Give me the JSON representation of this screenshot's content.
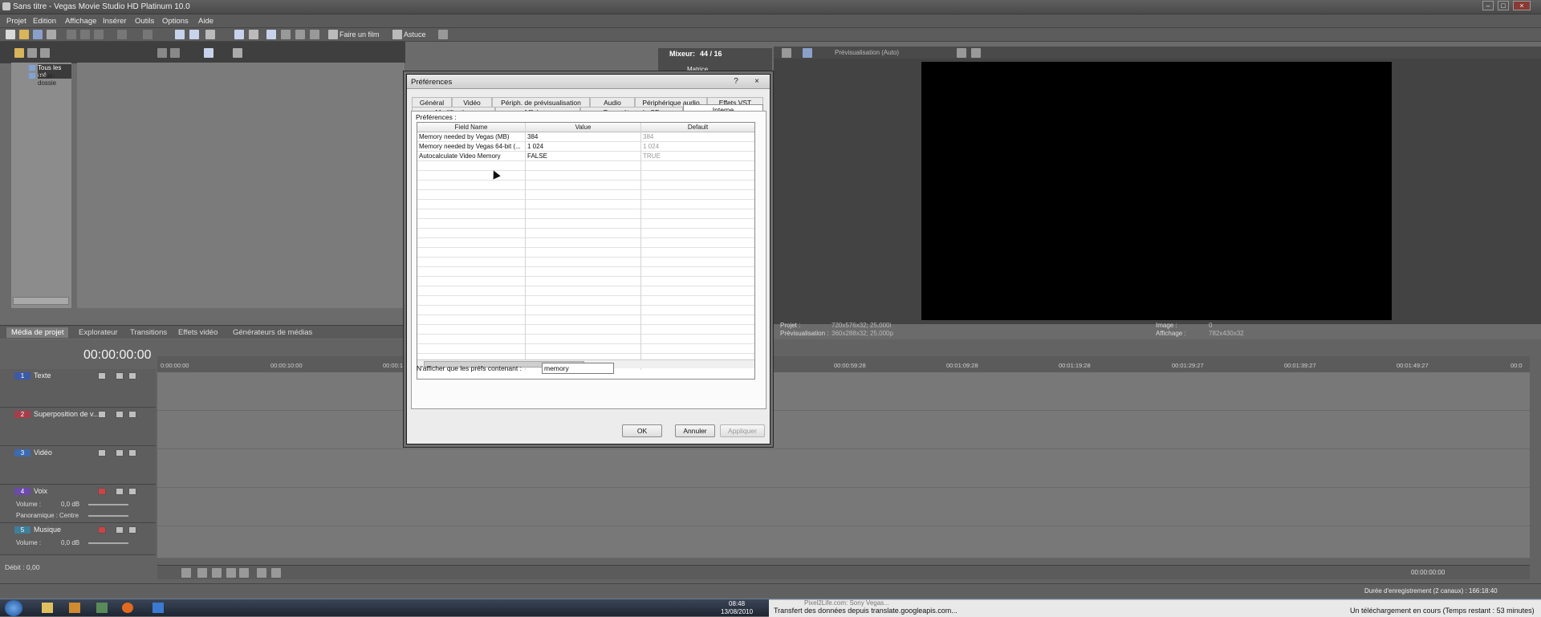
{
  "window": {
    "title": "Sans titre - Vegas Movie Studio HD Platinum 10.0"
  },
  "menu": [
    "Projet",
    "Edition",
    "Affichage",
    "Insérer",
    "Outils",
    "Options",
    "Aide"
  ],
  "toolbar": {
    "make_movie": "Faire un film",
    "tip": "Astuce"
  },
  "explorer": {
    "items": [
      "Tous les mé",
      "Sous-dossie"
    ]
  },
  "mixer": {
    "label": "Mixeur:",
    "value": "44 / 16",
    "item": "Matrice"
  },
  "preview": {
    "mode": "Prévisualisation (Auto)",
    "project_label": "Projet :",
    "project_value": "720x576x32; 25,000i",
    "preview_label": "Prévisualisation :",
    "preview_value": "360x288x32; 25,000p",
    "image_label": "Image :",
    "image_value": "0",
    "display_label": "Affichage :",
    "display_value": "782x430x32"
  },
  "bottom_tabs": [
    "Média de projet",
    "Explorateur",
    "Transitions",
    "Effets vidéo",
    "Générateurs de médias"
  ],
  "timecode": "00:00:00:00",
  "ruler": [
    "0:00:00:00",
    "00:00:10:00",
    "00:00:19",
    "00:00:59:28",
    "00:01:09:28",
    "00:01:19:28",
    "00:01:29:27",
    "00:01:39:27",
    "00:01:49:27",
    "00:0"
  ],
  "tracks": [
    {
      "num": "1",
      "name": "Texte",
      "color": "#3d5aa8"
    },
    {
      "num": "2",
      "name": "Superposition de v...",
      "color": "#a83d4a"
    },
    {
      "num": "3",
      "name": "Vidéo",
      "color": "#3d6ab0"
    },
    {
      "num": "4",
      "name": "Voix",
      "color": "#6b4aa8",
      "volume_label": "Volume :",
      "volume": "0,0 dB",
      "pan_label": "Panoramique :",
      "pan": "Centre"
    },
    {
      "num": "5",
      "name": "Musique",
      "color": "#3f7f9a",
      "volume_label": "Volume :",
      "volume": "0,0 dB",
      "pan_label": "Panoramique :",
      "pan": "Centre"
    }
  ],
  "rate": "Débit : 0,00",
  "transport_time": "00:00:00:00",
  "record_duration": "Durée d'enregistrement (2 canaux) : 166:18:40",
  "dialog": {
    "title": "Préférences",
    "help": "?",
    "close": "×",
    "tabs_row1": [
      "Général",
      "Vidéo",
      "Périph. de prévisualisation",
      "Audio",
      "Périphérique audio",
      "Effets VST"
    ],
    "tabs_row2": [
      "Modification",
      "Affichage",
      "Paramètres du CD",
      "Interne"
    ],
    "prefs_label": "Préférences :",
    "columns": [
      "Field Name",
      "Value",
      "Default"
    ],
    "rows": [
      {
        "name": "Memory needed by Vegas (MB)",
        "value": "384",
        "default": "384"
      },
      {
        "name": "Memory needed by Vegas 64-bit (...",
        "value": "1 024",
        "default": "1 024"
      },
      {
        "name": "Autocalculate Video Memory",
        "value": "FALSE",
        "default": "TRUE"
      }
    ],
    "filter_label": "N'afficher que les préfs contenant :",
    "filter_value": "memory",
    "ok": "OK",
    "cancel": "Annuler",
    "apply": "Appliquer"
  },
  "taskbar": {
    "clock_time": "08:48",
    "clock_date": "13/08/2010",
    "transfer_tab": "Pixel2Life.com: Sony Vegas...",
    "status": "Transfert des données depuis translate.googleapis.com...",
    "download": "Un téléchargement en cours (Temps restant : 53 minutes)"
  }
}
